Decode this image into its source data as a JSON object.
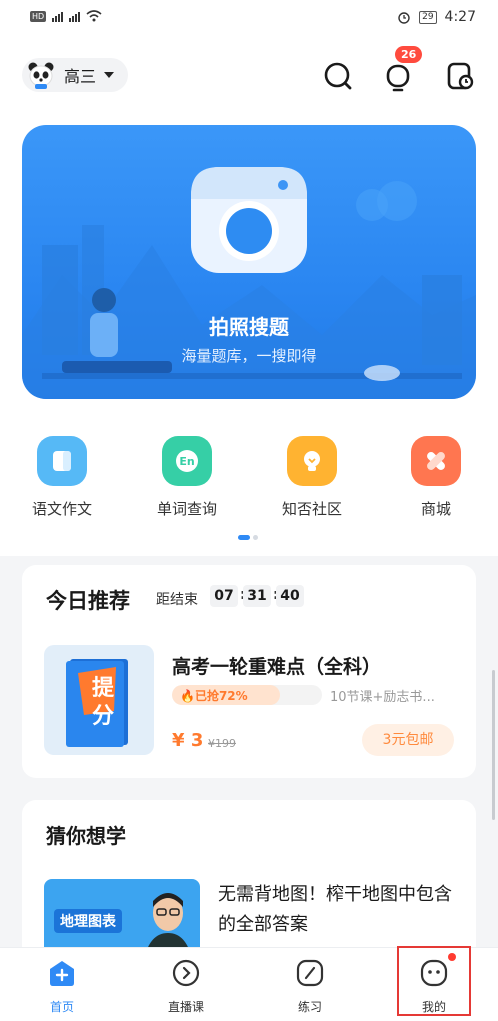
{
  "status_bar": {
    "left_icons": "HD 4G 4G wifi",
    "battery": "29",
    "time": "4:27"
  },
  "header": {
    "grade": "高三",
    "notification_count": "26",
    "icons": [
      "panda-avatar-icon",
      "search-icon",
      "bell-icon",
      "history-icon"
    ]
  },
  "banner": {
    "title": "拍照搜题",
    "subtitle": "海量题库，一搜即得"
  },
  "quick_links": [
    {
      "label": "语文作文",
      "color": "#56b9f6",
      "icon": "note-icon"
    },
    {
      "label": "单词查询",
      "color": "#36cfa6",
      "icon": "english-icon"
    },
    {
      "label": "知否社区",
      "color": "#ffb331",
      "icon": "bulb-icon"
    },
    {
      "label": "商城",
      "color": "#ff7650",
      "icon": "bandage-icon"
    }
  ],
  "today": {
    "title": "今日推荐",
    "countdown_label": "距结束",
    "hh": "07",
    "mm": "31",
    "ss": "40",
    "product": {
      "title": "高考一轮重难点（全科）",
      "progress_text": "🔥已抢72%",
      "progress": 0.72,
      "meta": "10节课+励志书...",
      "price_symbol": "¥",
      "price": "3",
      "original_price": "¥199",
      "ship": "3元包邮",
      "cover_text": "提分"
    }
  },
  "guess": {
    "title": "猜你想学",
    "thumb_label": "地理图表",
    "item_title": "无需背地图！榨干地图中包含的全部答案"
  },
  "tabs": [
    {
      "label": "首页",
      "icon": "home-icon",
      "active": true
    },
    {
      "label": "直播课",
      "icon": "play-icon",
      "active": false
    },
    {
      "label": "练习",
      "icon": "practice-icon",
      "active": false
    },
    {
      "label": "我的",
      "icon": "profile-icon",
      "active": false
    }
  ],
  "colors": {
    "accent": "#2f8af5",
    "orange": "#ff7a2e",
    "badge": "#ff4b3e"
  }
}
